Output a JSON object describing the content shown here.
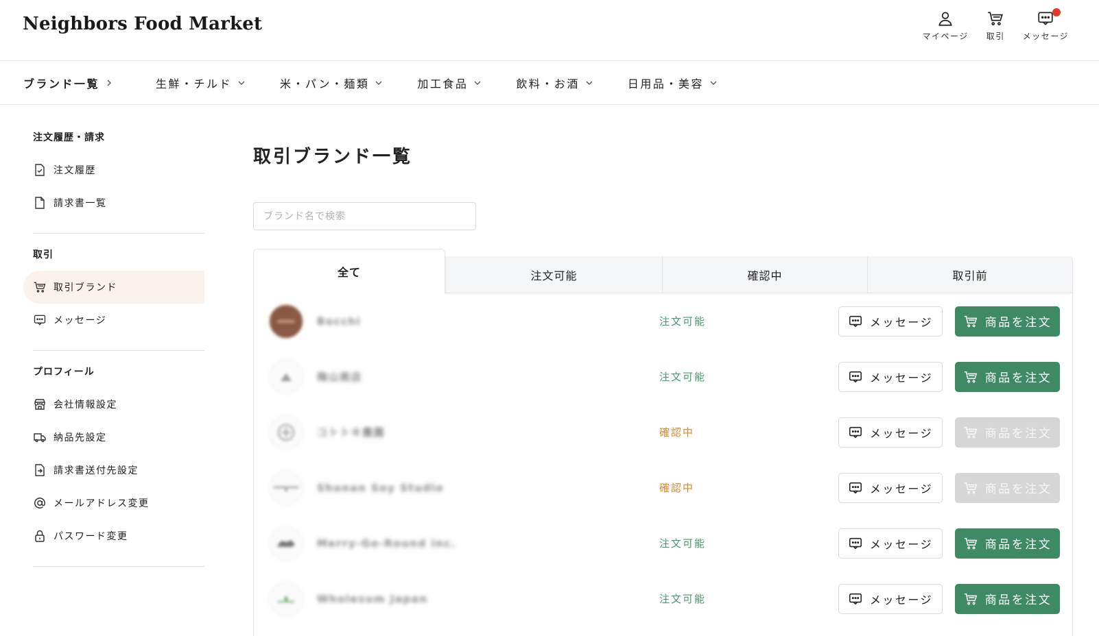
{
  "header": {
    "logo": "Neighbors Food Market",
    "actions": [
      {
        "label": "マイページ",
        "icon": "user-icon"
      },
      {
        "label": "取引",
        "icon": "cart-icon"
      },
      {
        "label": "メッセージ",
        "icon": "message-icon",
        "has_notification": true
      }
    ]
  },
  "catnav": {
    "brand_list": "ブランド一覧",
    "categories": [
      "生鮮・チルド",
      "米・パン・麺類",
      "加工食品",
      "飲料・お酒",
      "日用品・美容"
    ]
  },
  "sidebar": {
    "sections": [
      {
        "title": "注文履歴・請求",
        "items": [
          "注文履歴",
          "請求書一覧"
        ]
      },
      {
        "title": "取引",
        "items": [
          "取引ブランド",
          "メッセージ"
        ]
      },
      {
        "title": "プロフィール",
        "items": [
          "会社情報設定",
          "納品先設定",
          "請求書送付先設定",
          "メールアドレス変更",
          "パスワード変更"
        ]
      }
    ]
  },
  "main": {
    "title": "取引ブランド一覧",
    "search_placeholder": "ブランド名で検索",
    "tabs": [
      "全て",
      "注文可能",
      "確認中",
      "取引前"
    ],
    "message_label": "メッセージ",
    "order_label": "商品を注文",
    "rows": [
      {
        "name": "Bocchi",
        "status": "注文可能",
        "status_type": "ok"
      },
      {
        "name": "梅山商店",
        "status": "注文可能",
        "status_type": "ok"
      },
      {
        "name": "コトトキ農園",
        "status": "確認中",
        "status_type": "pending"
      },
      {
        "name": "Shonan Soy Studio",
        "status": "確認中",
        "status_type": "pending"
      },
      {
        "name": "Merry-Go-Round inc.",
        "status": "注文可能",
        "status_type": "ok"
      },
      {
        "name": "Wholesum Japan",
        "status": "注文可能",
        "status_type": "ok"
      }
    ]
  },
  "colors": {
    "accent_green": "#3d8a64",
    "status_ok": "#4a9a6f",
    "status_pending": "#e0882c",
    "notification": "#e53a26",
    "active_bg": "#fbf2ec"
  }
}
